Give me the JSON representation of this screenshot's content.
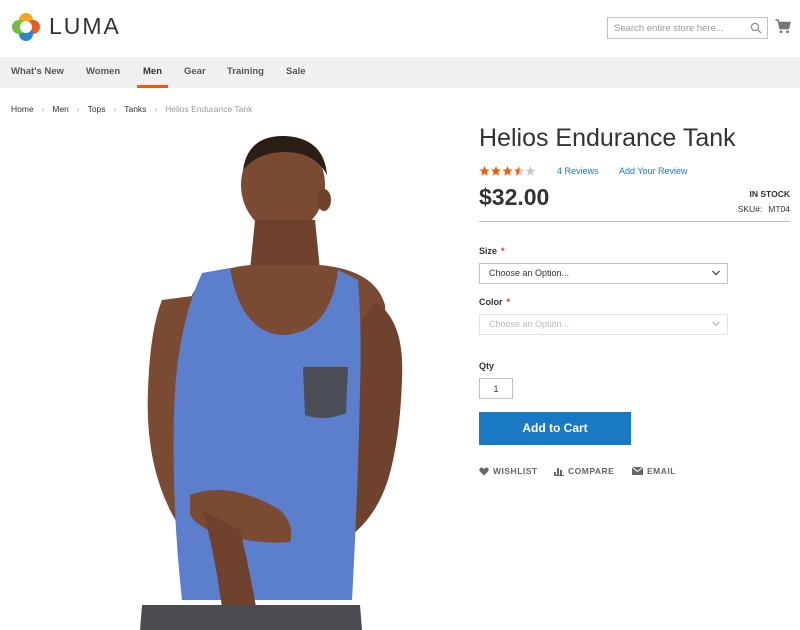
{
  "brand": {
    "name": "LUMA"
  },
  "search": {
    "placeholder": "Search entire store here..."
  },
  "nav": {
    "items": [
      {
        "label": "What's New",
        "active": false
      },
      {
        "label": "Women",
        "active": false
      },
      {
        "label": "Men",
        "active": true
      },
      {
        "label": "Gear",
        "active": false
      },
      {
        "label": "Training",
        "active": false
      },
      {
        "label": "Sale",
        "active": false
      }
    ]
  },
  "breadcrumb": {
    "items": [
      "Home",
      "Men",
      "Tops",
      "Tanks"
    ],
    "current": "Helios Endurance Tank"
  },
  "product": {
    "title": "Helios Endurance Tank",
    "rating": 3.5,
    "rating_max": 5,
    "reviews_label": "4  Reviews",
    "add_review_label": "Add Your Review",
    "price": "$32.00",
    "stock": "IN STOCK",
    "sku_label": "SKU#:",
    "sku": "MT04"
  },
  "options": {
    "size": {
      "label": "Size",
      "value": "Choose an Option..."
    },
    "color": {
      "label": "Color",
      "value": "Choose an Option..."
    }
  },
  "qty": {
    "label": "Qty",
    "value": "1"
  },
  "actions": {
    "add_to_cart": "Add to Cart",
    "wishlist": "WISHLIST",
    "compare": "COMPARE",
    "email": "EMAIL"
  },
  "colors": {
    "accent": "#ff5501",
    "primary": "#1979c3",
    "star": "#ff5501",
    "tank": "#5b7fcc"
  },
  "icons": [
    "luma-logo-icon",
    "search-icon",
    "cart-icon",
    "star-icon",
    "chevron-down-icon",
    "heart-icon",
    "bar-chart-icon",
    "envelope-icon"
  ]
}
